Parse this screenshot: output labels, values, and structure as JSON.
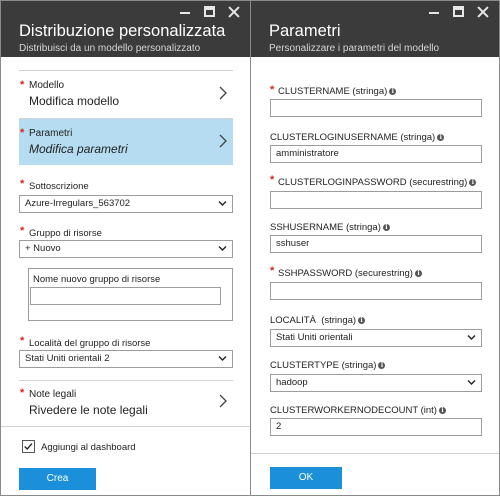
{
  "left": {
    "title": "Distribuzione personalizzata",
    "subtitle": "Distribuisci da un modello personalizzato",
    "nav": [
      {
        "label": "Modello",
        "value": "Modifica modello"
      },
      {
        "label": "Parametri",
        "value": "Modifica parametri"
      }
    ],
    "subscription": {
      "label": "Sottoscrizione",
      "value": "Azure-Irregulars_563702"
    },
    "resource_group": {
      "label": "Gruppo di risorse",
      "value": "+ Nuovo"
    },
    "new_group": {
      "label": "Nome nuovo gruppo di risorse",
      "value": ""
    },
    "location": {
      "label": "Località del gruppo di risorse",
      "value": "Stati Uniti orientali 2"
    },
    "legal": {
      "label": "Note legali",
      "value": "Rivedere le note legali"
    },
    "dashboard": {
      "label": "Aggiungi al dashboard",
      "checked": true
    },
    "create_label": "Crea",
    "required_mark": "*",
    "colors": {
      "header": "#3b3b3b",
      "selected": "#b5dcf0",
      "button": "#1b8fd9",
      "required": "#d9231c"
    }
  },
  "right": {
    "title": "Parametri",
    "subtitle": "Personalizzare i parametri del modello",
    "params": [
      {
        "label": "CLUSTERNAME (stringa)",
        "value": "",
        "required": true
      },
      {
        "label": "CLUSTERLOGINUSERNAME (stringa)",
        "value": "amministratore",
        "required": false
      },
      {
        "label": "CLUSTERLOGINPASSWORD (securestring)",
        "value": "",
        "required": true
      },
      {
        "label": "SSHUSERNAME (stringa)",
        "value": "sshuser",
        "required": false
      },
      {
        "label": "SSHPASSWORD (securestring)",
        "value": "",
        "required": true
      },
      {
        "label": "LOCALITÀ  (stringa)",
        "value": "Stati Uniti orientali",
        "required": false
      },
      {
        "label": "CLUSTERTYPE (stringa)",
        "value": "hadoop",
        "required": false
      },
      {
        "label": "CLUSTERWORKERNODECOUNT (int)",
        "value": "2",
        "required": false
      }
    ],
    "ok_label": "OK",
    "info_glyph": "i"
  },
  "icons": {
    "minimize": "minimize-icon",
    "maximize": "maximize-icon",
    "close": "close-icon",
    "chevron": "chevron-right-icon",
    "dropdown": "chevron-down-icon",
    "info": "info-icon",
    "check": "checkmark-icon"
  }
}
